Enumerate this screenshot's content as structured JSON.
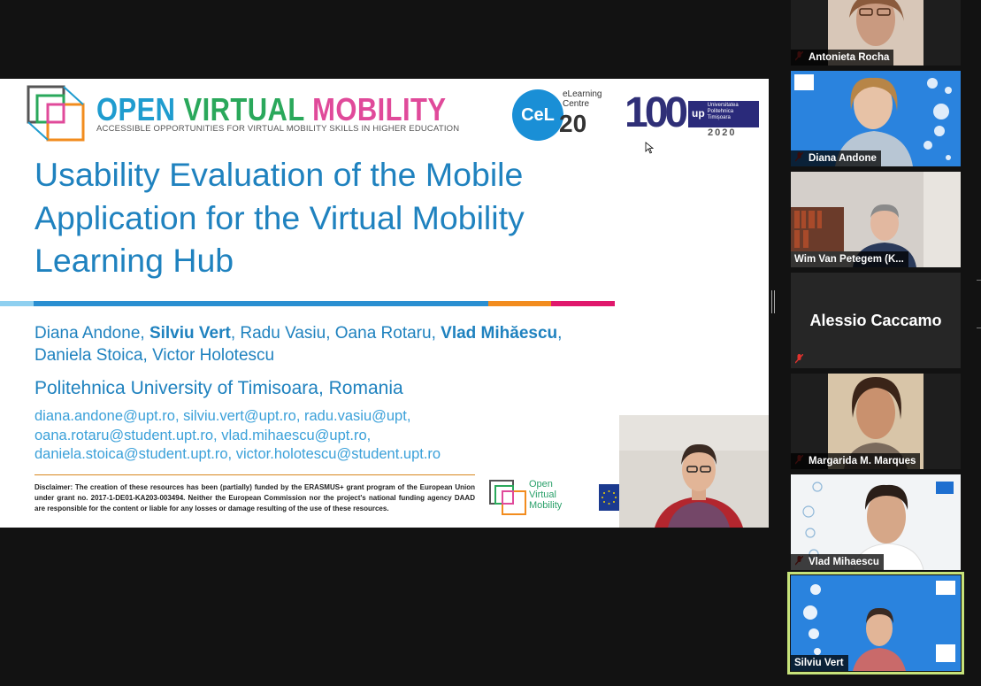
{
  "slide": {
    "brand_title_parts": [
      "OPEN ",
      "VIRTUAL ",
      "MOBILITY"
    ],
    "brand_colors": [
      "#1f9ccf",
      "#2aa85b",
      "#e04a9a"
    ],
    "brand_subtitle": "ACCESSIBLE OPPORTUNITIES FOR VIRTUAL MOBILITY SKILLS IN HIGHER EDUCATION",
    "elc_badge": "CeL",
    "elc_label_1": "eLearning",
    "elc_label_2": "Centre",
    "elc_year": "20",
    "centenary_number": "100",
    "centenary_badge": "up",
    "centenary_university": "Universitatea Politehnica Timișoara",
    "centenary_year": "2020",
    "title": "Usability Evaluation of the Mobile Application for the Virtual Mobility Learning Hub",
    "authors": [
      {
        "name": "Diana Andone",
        "bold": false
      },
      {
        "name": "Silviu Vert",
        "bold": true
      },
      {
        "name": "Radu Vasiu",
        "bold": false
      },
      {
        "name": "Oana Rotaru",
        "bold": false
      },
      {
        "name": "Vlad Mihăescu",
        "bold": true
      },
      {
        "name": "Daniela Stoica",
        "bold": false
      },
      {
        "name": "Victor Holotescu",
        "bold": false
      }
    ],
    "university": "Politehnica University of Timisoara, Romania",
    "emails_line1": "diana.andone@upt.ro, silviu.vert@upt.ro, radu.vasiu@upt,",
    "emails_line2": "oana.rotaru@student.upt.ro, vlad.mihaescu@upt.ro,",
    "emails_line3": "daniela.stoica@student.upt.ro, victor.holotescu@student.upt.ro",
    "disclaimer": "Disclaimer: The creation of these resources has been (partially) funded by the ERASMUS+ grant program of the European Union under grant no. 2017-1-DE01-KA203-003494. Neither the European Commission nor the project's national funding agency DAAD are responsible for the content or liable for any losses or damage resulting of the use of these resources.",
    "footer_logo_lines": [
      "Open",
      "Virtual",
      "Mobility"
    ],
    "rule_colors": [
      "#8fd0f0",
      "#2a8fd1",
      "#f28c1e",
      "#e0186c"
    ]
  },
  "participants": [
    {
      "name": "Antonieta Rocha",
      "muted": true
    },
    {
      "name": "Diana Andone",
      "muted": true
    },
    {
      "name": "Wim Van Petegem (K...",
      "muted": false
    },
    {
      "name": "Alessio Caccamo",
      "muted": true
    },
    {
      "name": "Margarida M. Marques",
      "muted": true
    },
    {
      "name": "Vlad Mihaescu",
      "muted": true
    },
    {
      "name": "Silviu Vert",
      "muted": false,
      "active": true
    }
  ],
  "colors": {
    "slide_blue": "#1f82bf",
    "active_speaker_border": "#c6e27a",
    "muted_icon": "#e0322d"
  }
}
